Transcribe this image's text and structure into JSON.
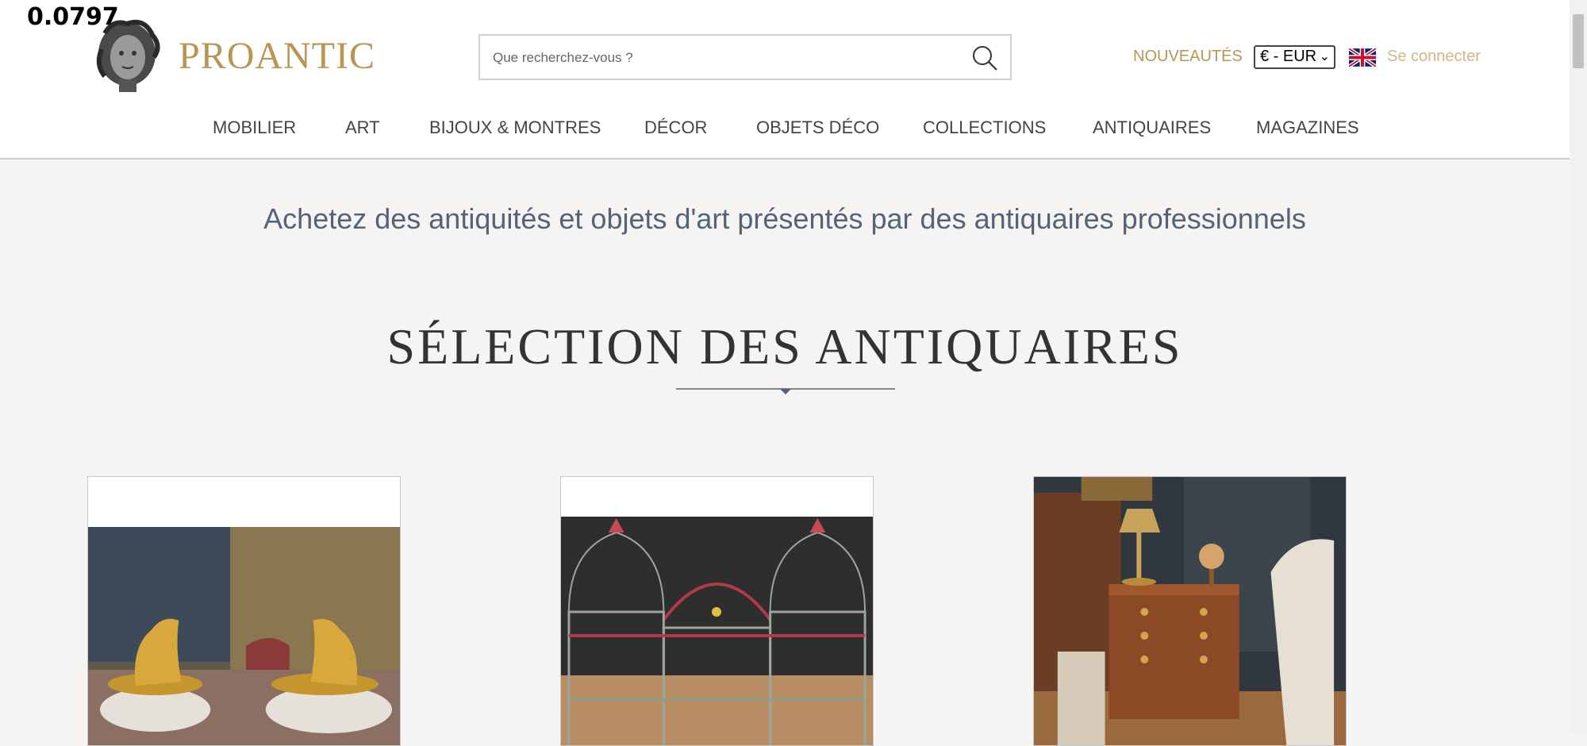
{
  "overlay": {
    "value": "0.0797"
  },
  "header": {
    "brand": "PROANTIC",
    "search": {
      "placeholder": "Que recherchez-vous ?",
      "value": ""
    },
    "nouveautes": "NOUVEAUTÉS",
    "currency": "€ - EUR",
    "login": "Se connecter",
    "language_flag": "uk-flag-icon"
  },
  "nav": {
    "items": [
      {
        "label": "MOBILIER"
      },
      {
        "label": "ART"
      },
      {
        "label": "BIJOUX & MONTRES"
      },
      {
        "label": "DÉCOR"
      },
      {
        "label": "OBJETS DÉCO"
      },
      {
        "label": "COLLECTIONS"
      },
      {
        "label": "ANTIQUAIRES"
      },
      {
        "label": "MAGAZINES"
      }
    ]
  },
  "main": {
    "tagline": "Achetez des antiquités et objets d'art présentés par des antiquaires professionnels",
    "section_title": "SÉLECTION DES ANTIQUAIRES"
  },
  "colors": {
    "brand_gold": "#b99553",
    "tagline_blue": "#556377",
    "background": "#f6f4f3"
  }
}
